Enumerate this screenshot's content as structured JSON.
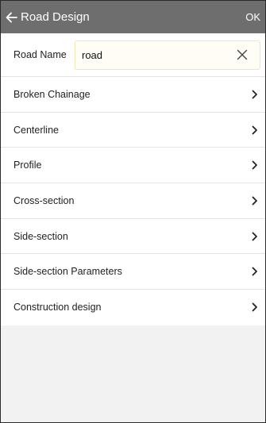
{
  "header": {
    "title": "Road Design",
    "back_icon": "arrow-left-icon",
    "ok_label": "OK",
    "bg_color": "#6e6e6e"
  },
  "road_name": {
    "label": "Road Name",
    "value": "road",
    "clear_icon": "close-icon"
  },
  "menu": {
    "items": [
      {
        "label": "Broken Chainage",
        "icon": "chevron-right-icon"
      },
      {
        "label": "Centerline",
        "icon": "chevron-right-icon"
      },
      {
        "label": "Profile",
        "icon": "chevron-right-icon"
      },
      {
        "label": "Cross-section",
        "icon": "chevron-right-icon"
      },
      {
        "label": "Side-section",
        "icon": "chevron-right-icon"
      },
      {
        "label": "Side-section Parameters",
        "icon": "chevron-right-icon"
      },
      {
        "label": "Construction design",
        "icon": "chevron-right-icon"
      }
    ]
  }
}
